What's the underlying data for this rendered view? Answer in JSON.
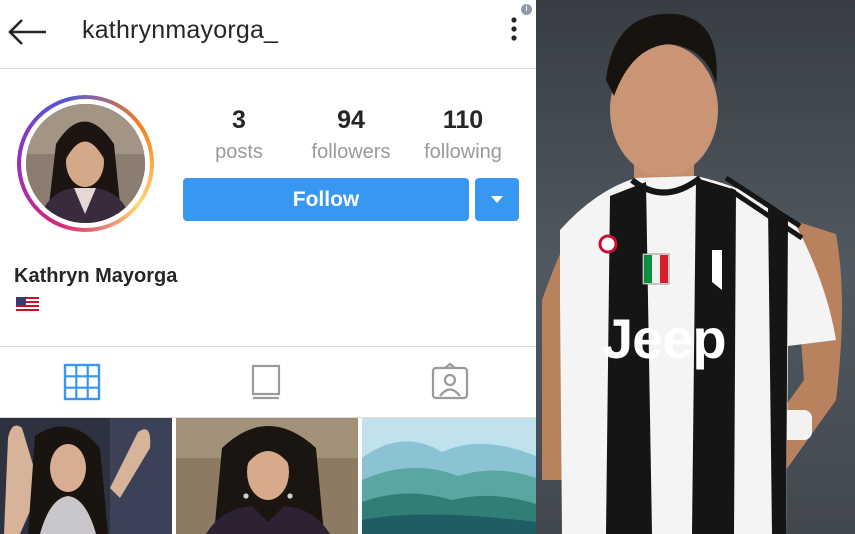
{
  "header": {
    "username": "kathrynmayorga_",
    "back_icon": "arrow-left-icon",
    "menu_icon": "more-vertical-icon",
    "info_badge": "i"
  },
  "profile": {
    "stats": [
      {
        "value": "3",
        "label": "posts"
      },
      {
        "value": "94",
        "label": "followers"
      },
      {
        "value": "110",
        "label": "following"
      }
    ],
    "follow_label": "Follow",
    "full_name": "Kathryn Mayorga",
    "bio_emoji": "us-flag-icon"
  },
  "tabs": [
    {
      "icon": "grid-icon",
      "active": true
    },
    {
      "icon": "feed-icon",
      "active": false
    },
    {
      "icon": "tagged-photos-icon",
      "active": false
    }
  ],
  "colors": {
    "accent": "#3897f0",
    "text": "#262626",
    "muted": "#9a9a9a"
  },
  "photo": {
    "jersey_brand": "Jeep"
  }
}
